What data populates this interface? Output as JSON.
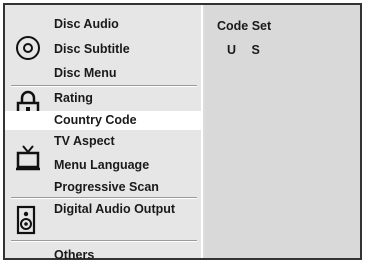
{
  "sidebar": {
    "groups": [
      {
        "icon": "disc-icon",
        "items": [
          "Disc Audio",
          "Disc Subtitle",
          "Disc Menu"
        ]
      },
      {
        "icon": "lock-icon",
        "items": [
          "Rating",
          "Country Code"
        ]
      },
      {
        "icon": "tv-icon",
        "items": [
          "TV Aspect",
          "Menu Language",
          "Progressive Scan"
        ]
      },
      {
        "icon": "speaker-icon",
        "items": [
          "Digital Audio Output"
        ]
      },
      {
        "icon": "",
        "items": [
          "Others"
        ]
      }
    ],
    "selected": "Country Code"
  },
  "content": {
    "title": "Code Set",
    "value": "U S"
  },
  "colors": {
    "panel": "#d9d9d9",
    "selected_bg": "#ffffff",
    "text": "#1a1a1a"
  }
}
